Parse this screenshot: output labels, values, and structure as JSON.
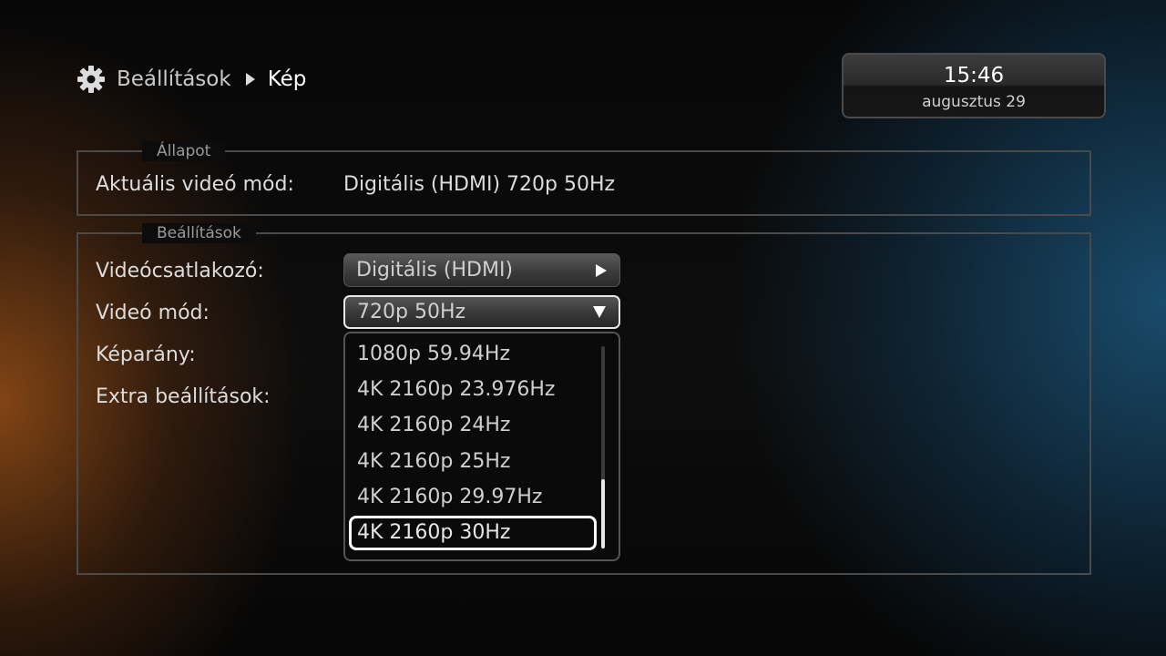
{
  "breadcrumb": {
    "icon": "gear-icon",
    "root": "Beállítások",
    "current": "Kép"
  },
  "clock": {
    "time": "15:46",
    "date": "augusztus 29"
  },
  "status": {
    "legend": "Állapot",
    "current_mode_label": "Aktuális videó mód:",
    "current_mode_value": "Digitális (HDMI) 720p 50Hz"
  },
  "settings": {
    "legend": "Beállítások",
    "connector_label": "Videócsatlakozó:",
    "connector_value": "Digitális (HDMI)",
    "mode_label": "Videó mód:",
    "mode_value": "720p 50Hz",
    "aspect_label": "Képarány:",
    "extra_label": "Extra beállítások:"
  },
  "dropdown": {
    "options": [
      "1080p 59.94Hz",
      "4K 2160p 23.976Hz",
      "4K 2160p 24Hz",
      "4K 2160p 25Hz",
      "4K 2160p 29.97Hz",
      "4K 2160p 30Hz"
    ],
    "selected_index": 5
  },
  "colors": {
    "accent": "#ffffff",
    "frame": "#4a4a4a"
  }
}
